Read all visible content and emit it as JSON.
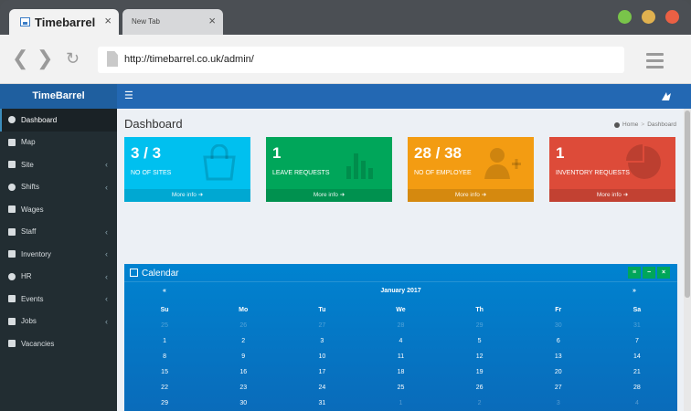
{
  "browser": {
    "tabs": [
      {
        "title": "Timebarrel",
        "active": true
      },
      {
        "title": "New Tab",
        "active": false
      }
    ],
    "close_glyph": "×",
    "url": "http://timebarrel.co.uk/admin/"
  },
  "app": {
    "logo": "TimeBarrel",
    "sidebar": [
      {
        "label": "Dashboard",
        "icon": "dashboard-icon",
        "active": true,
        "caret": false
      },
      {
        "label": "Map",
        "icon": "map-marker-icon",
        "active": false,
        "caret": false
      },
      {
        "label": "Site",
        "icon": "building-icon",
        "active": false,
        "caret": true
      },
      {
        "label": "Shifts",
        "icon": "clock-icon",
        "active": false,
        "caret": true
      },
      {
        "label": "Wages",
        "icon": "credit-card-icon",
        "active": false,
        "caret": false
      },
      {
        "label": "Staff",
        "icon": "users-icon",
        "active": false,
        "caret": true
      },
      {
        "label": "Inventory",
        "icon": "laptop-icon",
        "active": false,
        "caret": true
      },
      {
        "label": "HR",
        "icon": "user-icon",
        "active": false,
        "caret": true
      },
      {
        "label": "Events",
        "icon": "calendar-icon",
        "active": false,
        "caret": true
      },
      {
        "label": "Jobs",
        "icon": "folder-icon",
        "active": false,
        "caret": true
      },
      {
        "label": "Vacancies",
        "icon": "credit-card-icon",
        "active": false,
        "caret": false
      }
    ],
    "caret_glyph": "‹",
    "page_title": "Dashboard",
    "breadcrumb": {
      "home": "Home",
      "separator": ">",
      "current": "Dashboard"
    },
    "stats": [
      {
        "number": "3 / 3",
        "label": "NO OF SITES",
        "footer": "More info",
        "color": "#00c0ef",
        "icon": "shopping-bag-icon"
      },
      {
        "number": "1",
        "label": "LEAVE REQUESTS",
        "footer": "More info",
        "color": "#00a65a",
        "icon": "bar-chart-icon"
      },
      {
        "number": "28 / 38",
        "label": "NO OF EMPLOYEE",
        "footer": "More info",
        "color": "#f39c12",
        "icon": "user-plus-icon"
      },
      {
        "number": "1",
        "label": "INVENTORY REQUESTS",
        "footer": "More info",
        "color": "#dd4b39",
        "icon": "pie-chart-icon"
      }
    ],
    "calendar": {
      "title": "Calendar",
      "month": "January 2017",
      "prev": "«",
      "next": "»",
      "tools": [
        "≡",
        "−",
        "×"
      ],
      "weekdays": [
        "Su",
        "Mo",
        "Tu",
        "We",
        "Th",
        "Fr",
        "Sa"
      ],
      "weeks": [
        [
          [
            "25",
            true
          ],
          [
            "26",
            true
          ],
          [
            "27",
            true
          ],
          [
            "28",
            true
          ],
          [
            "29",
            true
          ],
          [
            "30",
            true
          ],
          [
            "31",
            true
          ]
        ],
        [
          [
            "1",
            false
          ],
          [
            "2",
            false
          ],
          [
            "3",
            false
          ],
          [
            "4",
            false
          ],
          [
            "5",
            false
          ],
          [
            "6",
            false
          ],
          [
            "7",
            false
          ]
        ],
        [
          [
            "8",
            false
          ],
          [
            "9",
            false
          ],
          [
            "10",
            false
          ],
          [
            "11",
            false
          ],
          [
            "12",
            false
          ],
          [
            "13",
            false
          ],
          [
            "14",
            false
          ]
        ],
        [
          [
            "15",
            false
          ],
          [
            "16",
            false
          ],
          [
            "17",
            false
          ],
          [
            "18",
            false
          ],
          [
            "19",
            false
          ],
          [
            "20",
            false
          ],
          [
            "21",
            false
          ]
        ],
        [
          [
            "22",
            false
          ],
          [
            "23",
            false
          ],
          [
            "24",
            false
          ],
          [
            "25",
            false
          ],
          [
            "26",
            false
          ],
          [
            "27",
            false
          ],
          [
            "28",
            false
          ]
        ],
        [
          [
            "29",
            false
          ],
          [
            "30",
            false
          ],
          [
            "31",
            false
          ],
          [
            "1",
            true
          ],
          [
            "2",
            true
          ],
          [
            "3",
            true
          ],
          [
            "4",
            true
          ]
        ]
      ]
    }
  }
}
